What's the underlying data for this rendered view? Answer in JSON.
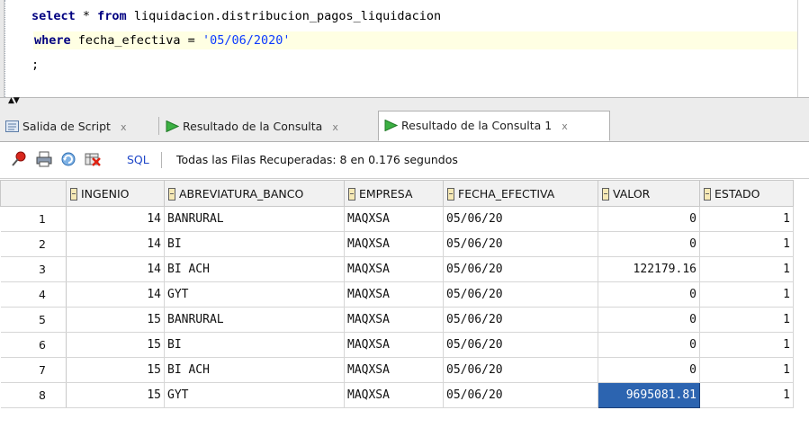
{
  "editor": {
    "line1": {
      "kw": "select",
      "rest": " * ",
      "kw2": "from",
      "rest2": " liquidacion.distribucion_pagos_liquidacion"
    },
    "line2": {
      "kw": "where",
      "rest": " fecha_efectiva = ",
      "str": "'05/06/2020'"
    },
    "line3": {
      "text": ";"
    }
  },
  "tabs": [
    {
      "label": "Salida de Script",
      "close": "x",
      "icon": "script-output-icon"
    },
    {
      "label": "Resultado de la Consulta",
      "close": "x",
      "icon": "green-play-icon"
    },
    {
      "label": "Resultado de la Consulta 1",
      "close": "x",
      "icon": "green-play-icon",
      "active": true
    }
  ],
  "toolbar": {
    "icons": [
      "pin-icon",
      "print-icon",
      "refresh-icon",
      "clear-icon"
    ],
    "sql_label": "SQL",
    "status": "Todas las Filas Recuperadas: 8 en 0.176 segundos"
  },
  "grid": {
    "columns": [
      "INGENIO",
      "ABREVIATURA_BANCO",
      "EMPRESA",
      "FECHA_EFECTIVA",
      "VALOR",
      "ESTADO"
    ],
    "rows": [
      {
        "n": "1",
        "cells": [
          "14",
          "BANRURAL",
          "MAQXSA",
          "05/06/20",
          "0",
          "1"
        ]
      },
      {
        "n": "2",
        "cells": [
          "14",
          "BI",
          "MAQXSA",
          "05/06/20",
          "0",
          "1"
        ]
      },
      {
        "n": "3",
        "cells": [
          "14",
          "BI ACH",
          "MAQXSA",
          "05/06/20",
          "122179.16",
          "1"
        ]
      },
      {
        "n": "4",
        "cells": [
          "14",
          "GYT",
          "MAQXSA",
          "05/06/20",
          "0",
          "1"
        ]
      },
      {
        "n": "5",
        "cells": [
          "15",
          "BANRURAL",
          "MAQXSA",
          "05/06/20",
          "0",
          "1"
        ]
      },
      {
        "n": "6",
        "cells": [
          "15",
          "BI",
          "MAQXSA",
          "05/06/20",
          "0",
          "1"
        ]
      },
      {
        "n": "7",
        "cells": [
          "15",
          "BI ACH",
          "MAQXSA",
          "05/06/20",
          "0",
          "1"
        ]
      },
      {
        "n": "8",
        "cells": [
          "15",
          "GYT",
          "MAQXSA",
          "05/06/20",
          "9695081.81",
          "1"
        ]
      }
    ],
    "selected_cell": {
      "row": 8,
      "column": "VALOR"
    },
    "selection_color": "#2c64b0"
  }
}
